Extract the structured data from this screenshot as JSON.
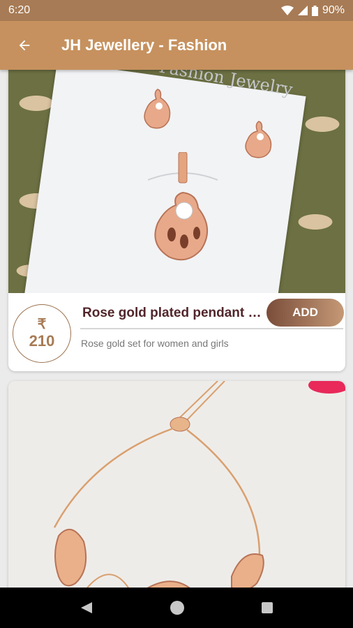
{
  "status_bar": {
    "time": "6:20",
    "battery": "90%"
  },
  "app_bar": {
    "title": "JH Jewellery - Fashion"
  },
  "products": [
    {
      "image_brand_text": "Fashion Jewelry",
      "currency": "₹",
      "price": "210",
      "title": "Rose gold plated pendant s...",
      "add_label": "ADD",
      "description": "Rose gold set for women and girls"
    }
  ],
  "colors": {
    "status_bar": "#a77b55",
    "app_bar": "#c6915e",
    "accent": "#a77b55",
    "title_text": "#51262b"
  },
  "icons": [
    "back-arrow-icon",
    "wifi-icon",
    "signal-icon",
    "battery-icon",
    "nav-back-icon",
    "nav-home-icon",
    "nav-recents-icon"
  ]
}
